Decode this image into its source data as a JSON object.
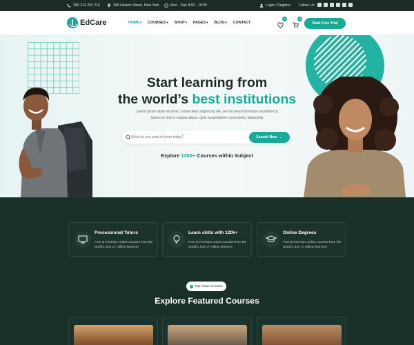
{
  "topbar": {
    "phone": "256 214 203 215",
    "address": "258 Helano Street, New York",
    "hours": "Mon - Sat: 8:00 - 15:00",
    "login": "Login / Register",
    "follow": "Follow Us",
    "social_icons": [
      "facebook-icon",
      "instagram-icon",
      "linkedin-icon",
      "behance-icon",
      "skype-icon",
      "youtube-icon"
    ]
  },
  "header": {
    "logo": "EdCare",
    "nav": [
      {
        "label": "HOME",
        "dropdown": true,
        "active": true
      },
      {
        "label": "COURSES",
        "dropdown": true,
        "active": false
      },
      {
        "label": "SHOP",
        "dropdown": true,
        "active": false
      },
      {
        "label": "PAGES",
        "dropdown": true,
        "active": false
      },
      {
        "label": "BLOG",
        "dropdown": true,
        "active": false
      },
      {
        "label": "CONTACT",
        "dropdown": false,
        "active": false
      }
    ],
    "wishlist_count": "0",
    "cart_count": "0",
    "cta": "Start Free Trial"
  },
  "hero": {
    "title_line1": "Start learning from",
    "title_line2_a": "the world’s ",
    "title_line2_b": "best institutions",
    "subtitle": "Lorem ipsum dolor sit amet, consectetur adipiscing elit, sed do eiusmod tempo incididunt ut labore et dolore magna aliqua. Quis suspendisse consectetur adipiscing",
    "search_placeholder": "What do you want to learn today?",
    "search_button": "Search Now",
    "explore_a": "Explore ",
    "explore_count": "1350+",
    "explore_b": " Courses within Subject"
  },
  "features": [
    {
      "title": "Processional Tutors",
      "desc": "Free & Premium online courses from the world's Join 17 million learners",
      "icon": "tutor-icon"
    },
    {
      "title": "Learn skills with 120k+",
      "desc": "Free & Premium online courses from the world's Join 17 million learners",
      "icon": "lightbulb-icon"
    },
    {
      "title": "Online Degrees",
      "desc": "Free & Premium online courses from the world's Join 17 million learners",
      "icon": "graduation-cap-icon"
    }
  ],
  "courses_section": {
    "pill": "Top Class Courses",
    "title": "Explore Featured Courses"
  },
  "colors": {
    "accent": "#18a999",
    "dark_bg": "#193029",
    "topbar_bg": "#1d2b28"
  }
}
